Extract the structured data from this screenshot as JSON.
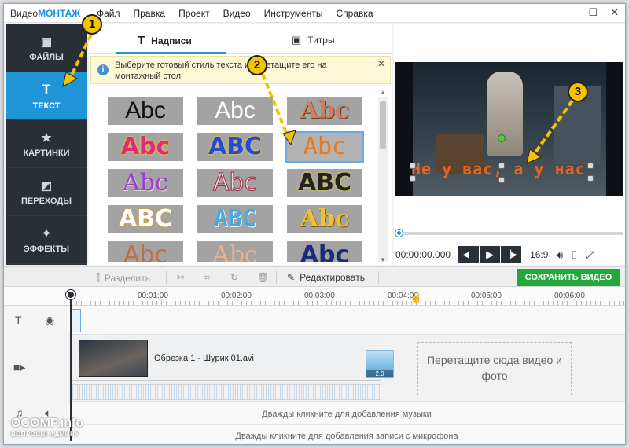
{
  "app": {
    "logo_prefix": "Видео",
    "logo_suffix": "МОНТАЖ"
  },
  "menu": [
    "Файл",
    "Правка",
    "Проект",
    "Видео",
    "Инструменты",
    "Справка"
  ],
  "window_buttons": {
    "minimize": "—",
    "maximize": "☐",
    "close": "✕"
  },
  "sidebar": {
    "items": [
      {
        "label": "ФАЙЛЫ",
        "icon": "image-icon"
      },
      {
        "label": "ТЕКСТ",
        "icon": "text-icon",
        "active": true
      },
      {
        "label": "КАРТИНКИ",
        "icon": "star-icon"
      },
      {
        "label": "ПЕРЕХОДЫ",
        "icon": "transitions-icon"
      },
      {
        "label": "ЭФФЕКТЫ",
        "icon": "magic-wand-icon"
      }
    ]
  },
  "library": {
    "tabs": [
      {
        "label": "Надписи",
        "active": true
      },
      {
        "label": "Титры"
      }
    ],
    "hint": "Выберите готовый стиль текста и перетащите его на монтажный стол.",
    "hint_close": "✕",
    "styles": [
      {
        "text": "Abc"
      },
      {
        "text": "Abc"
      },
      {
        "text": "Abc"
      },
      {
        "text": "Abc"
      },
      {
        "text": "ABC"
      },
      {
        "text": "Abc",
        "selected": true
      },
      {
        "text": "Abc"
      },
      {
        "text": "Abc"
      },
      {
        "text": "ABC"
      },
      {
        "text": "ABC"
      },
      {
        "text": "ABC"
      },
      {
        "text": "Abc"
      },
      {
        "text": "Abc"
      },
      {
        "text": "Abc"
      },
      {
        "text": "Abc"
      }
    ]
  },
  "preview": {
    "caption": "Не у вас, а у нас",
    "time": "00:00:00.000",
    "ratio": "16:9",
    "progress": 0
  },
  "toolbar": {
    "split": "Разделить",
    "edit": "Редактировать",
    "save": "СОХРАНИТЬ ВИДЕО"
  },
  "ruler": {
    "ticks": [
      "00:01:00",
      "00:02:00",
      "00:03:00",
      "00:04:00",
      "00:05:00",
      "00:06:00"
    ]
  },
  "timeline": {
    "clip_name": "Обрезка 1 - Шурик 01.avi",
    "transition_duration": "2.0",
    "drop_text": "Перетащите сюда видео и фото",
    "music_hint": "Дважды кликните для добавления музыки",
    "mic_hint": "Дважды кликните для добавления записи с микрофона"
  },
  "annotations": {
    "marker1": "1",
    "marker2": "2",
    "marker3": "3"
  },
  "watermark": {
    "title": "OCOMP.info",
    "subtitle": "ВОПРОСЫ АДМИНУ"
  },
  "colors": {
    "accent": "#1f95d8",
    "save": "#23a83c",
    "caption": "#e7641f",
    "marker": "#f6c300"
  }
}
